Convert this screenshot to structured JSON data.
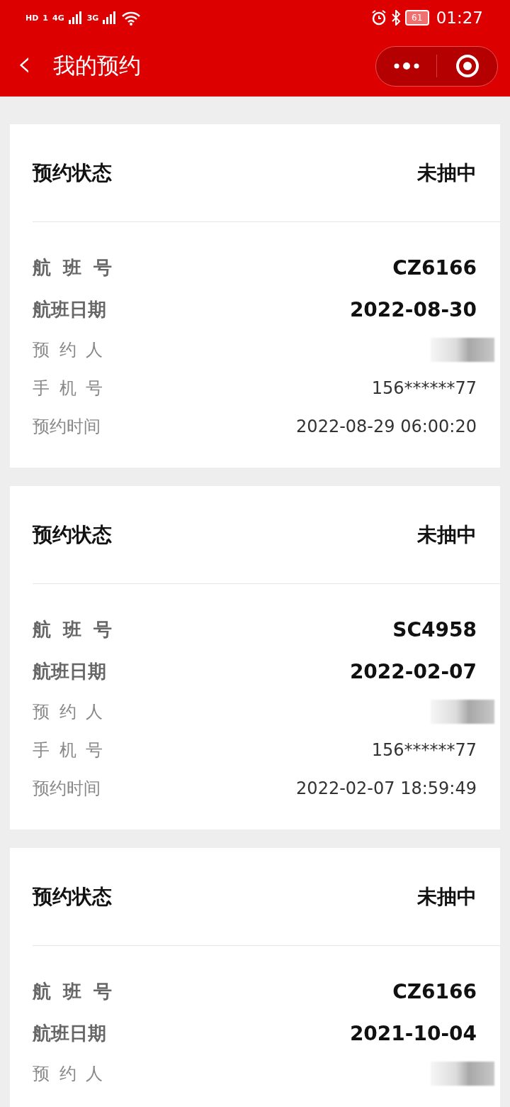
{
  "status_bar": {
    "left_badges": [
      "HD",
      "1",
      "4G",
      "3G"
    ],
    "battery": "61",
    "time": "01:27"
  },
  "nav": {
    "back": "‹",
    "title": "我的预约"
  },
  "reservations": [
    {
      "status_label": "预约状态",
      "status": "未抽中",
      "rows": [
        {
          "kind": "bold",
          "label": "航 班 号",
          "value": "CZ6166"
        },
        {
          "kind": "bold",
          "label": "航班日期",
          "value": "2022-08-30"
        },
        {
          "kind": "redacted",
          "label": "预 约 人"
        },
        {
          "kind": "plain",
          "label": "手 机 号",
          "value": "156******77"
        },
        {
          "kind": "plain",
          "label": "预约时间",
          "value": "2022-08-29 06:00:20"
        }
      ]
    },
    {
      "status_label": "预约状态",
      "status": "未抽中",
      "rows": [
        {
          "kind": "bold",
          "label": "航 班 号",
          "value": "SC4958"
        },
        {
          "kind": "bold",
          "label": "航班日期",
          "value": "2022-02-07"
        },
        {
          "kind": "redacted",
          "label": "预 约 人"
        },
        {
          "kind": "plain",
          "label": "手 机 号",
          "value": "156******77"
        },
        {
          "kind": "plain",
          "label": "预约时间",
          "value": "2022-02-07 18:59:49"
        }
      ]
    },
    {
      "status_label": "预约状态",
      "status": "未抽中",
      "rows": [
        {
          "kind": "bold",
          "label": "航 班 号",
          "value": "CZ6166"
        },
        {
          "kind": "bold",
          "label": "航班日期",
          "value": "2021-10-04"
        },
        {
          "kind": "redacted",
          "label": "预 约 人"
        }
      ]
    }
  ]
}
